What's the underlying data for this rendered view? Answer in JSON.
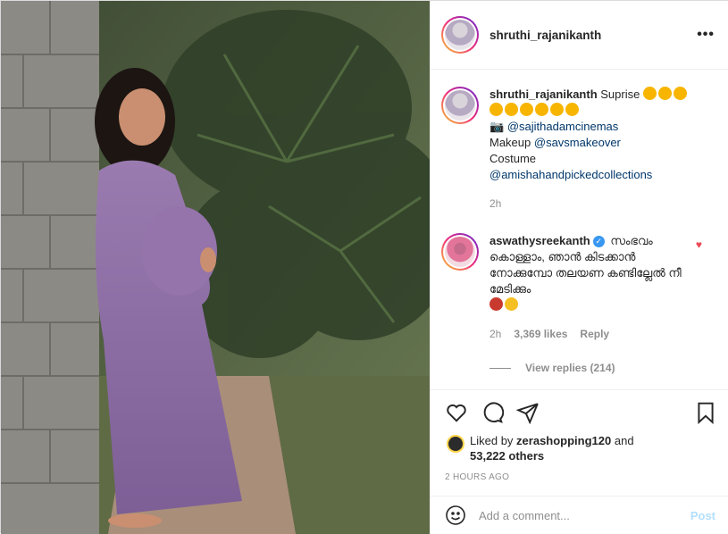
{
  "post": {
    "username": "shruthi_rajanikanth",
    "more_label": "•••"
  },
  "caption": {
    "username": "shruthi_rajanikanth",
    "text": "Suprise",
    "line2_prefix": "📷 ",
    "photo_credit": "@sajithadamcinemas",
    "makeup_label": "Makeup ",
    "makeup_credit": "@savsmakeover",
    "costume_label": "Costume",
    "costume_credit": "@amishahandpickedcollections",
    "time": "2h"
  },
  "comment": {
    "username": "aswathysreekanth",
    "verified_mark": "✓",
    "text": "സംഭവം കൊള്ളാം, ഞാൻ കിടക്കാൻ നോക്കുമ്പോ തലയണ കണ്ടില്ലേൽ നീ മേടിക്കും",
    "time": "2h",
    "likes": "3,369 likes",
    "reply_label": "Reply",
    "view_replies": "View replies (214)",
    "liked_icon": "heart-filled-icon",
    "heart_glyph": "♥"
  },
  "actions": {
    "liked_by_prefix": "Liked by ",
    "liked_by_user": "zerashopping120",
    "liked_by_and": " and",
    "liked_by_others": "53,222 others",
    "timestamp": "2 HOURS AGO"
  },
  "add_comment": {
    "placeholder": "Add a comment...",
    "post_label": "Post"
  },
  "colors": {
    "link": "#00376b",
    "muted": "#8e8e8e",
    "heart": "#ed4956",
    "post_disabled": "#b2dffc"
  }
}
